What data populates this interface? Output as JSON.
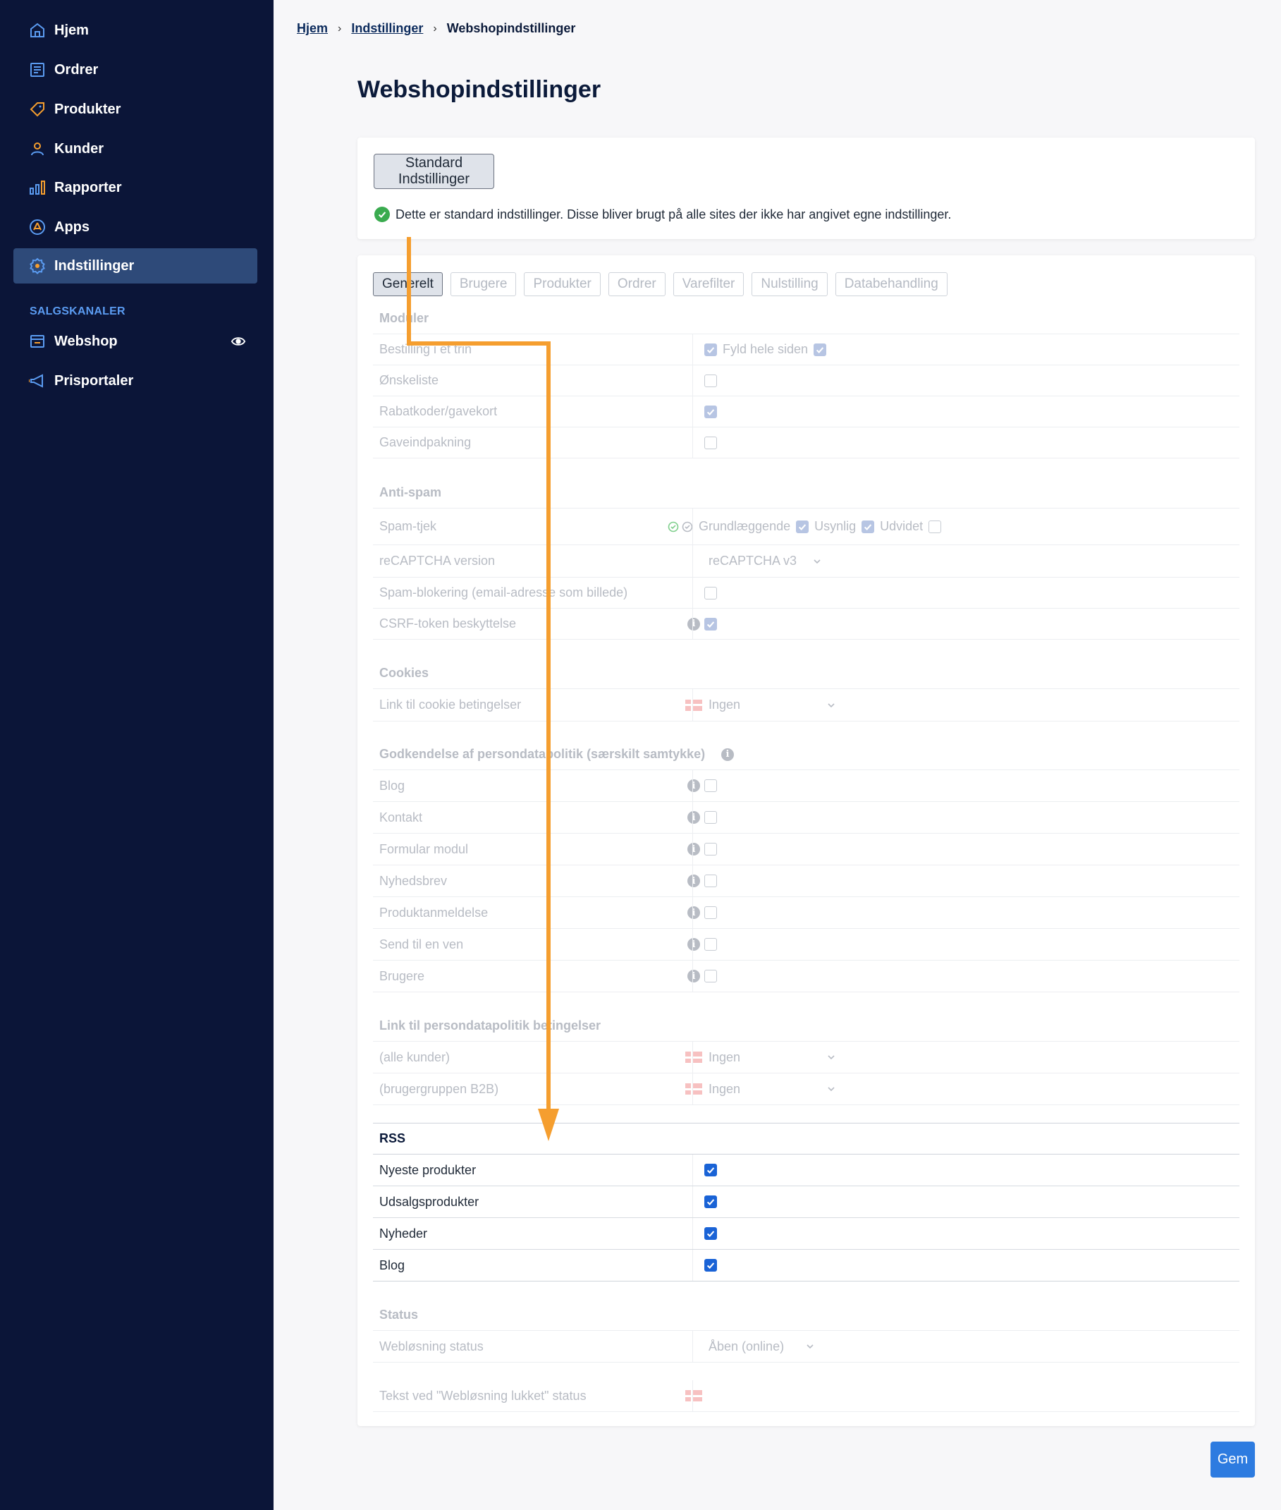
{
  "sidebar": {
    "items": [
      {
        "label": "Hjem",
        "icon": "home-icon"
      },
      {
        "label": "Ordrer",
        "icon": "orders-icon"
      },
      {
        "label": "Produkter",
        "icon": "tag-icon"
      },
      {
        "label": "Kunder",
        "icon": "user-icon"
      },
      {
        "label": "Rapporter",
        "icon": "bar-chart-icon"
      },
      {
        "label": "Apps",
        "icon": "apps-icon"
      },
      {
        "label": "Indstillinger",
        "icon": "gear-icon",
        "active": true
      }
    ],
    "section_label": "SALGSKANALER",
    "channels": [
      {
        "label": "Webshop",
        "icon": "store-icon"
      },
      {
        "label": "Prisportaler",
        "icon": "megaphone-icon"
      }
    ]
  },
  "breadcrumb": {
    "home": "Hjem",
    "settings": "Indstillinger",
    "current": "Webshopindstillinger"
  },
  "page_title": "Webshopindstillinger",
  "standard": {
    "button": "Standard Indstillinger",
    "info": "Dette er standard indstillinger. Disse bliver brugt på alle sites der ikke har angivet egne indstillinger."
  },
  "tabs": [
    "Generelt",
    "Brugere",
    "Produkter",
    "Ordrer",
    "Varefilter",
    "Nulstilling",
    "Databehandling"
  ],
  "sections": {
    "moduler": {
      "title": "Moduler",
      "rows": [
        "Bestilling i et trin",
        "Ønskeliste",
        "Rabatkoder/gavekort",
        "Gaveindpakning"
      ],
      "fyld_label": "Fyld hele siden"
    },
    "antispam": {
      "title": "Anti-spam",
      "spam_label": "Spam-tjek",
      "spam_opts": [
        "Grundlæggende",
        "Usynlig",
        "Udvidet"
      ],
      "recaptcha_label": "reCAPTCHA version",
      "recaptcha_value": "reCAPTCHA v3",
      "blocking_label": "Spam-blokering (email-adresse som billede)",
      "csrf_label": "CSRF-token beskyttelse"
    },
    "cookies": {
      "title": "Cookies",
      "link_label": "Link til cookie betingelser",
      "link_value": "Ingen"
    },
    "godkendelse": {
      "title": "Godkendelse af persondatapolitik (særskilt samtykke)",
      "rows": [
        "Blog",
        "Kontakt",
        "Formular modul",
        "Nyhedsbrev",
        "Produktanmeldelse",
        "Send til en ven",
        "Brugere"
      ]
    },
    "persondata_link": {
      "title": "Link til persondatapolitik betingelser",
      "rows": [
        {
          "label": "(alle kunder)",
          "value": "Ingen"
        },
        {
          "label": "(brugergruppen B2B)",
          "value": "Ingen"
        }
      ]
    },
    "rss": {
      "title": "RSS",
      "rows": [
        "Nyeste produkter",
        "Udsalgsprodukter",
        "Nyheder",
        "Blog"
      ]
    },
    "status": {
      "title": "Status",
      "web_label": "Webløsning status",
      "web_value": "Åben (online)",
      "closed_label": "Tekst ved \"Webløsning lukket\" status"
    }
  },
  "save_button": "Gem",
  "colors": {
    "sidebar_bg": "#0b1538",
    "active_nav": "#2e4a79",
    "accent": "#2d7be0",
    "annotation_arrow": "#f59e2f"
  }
}
